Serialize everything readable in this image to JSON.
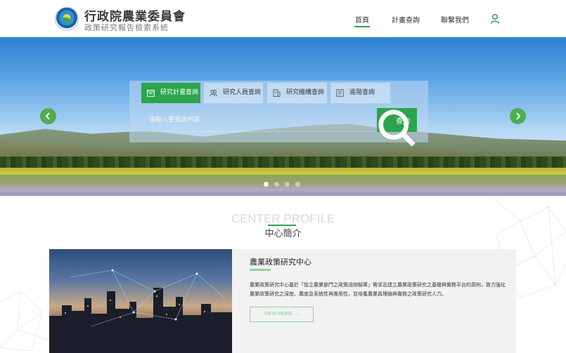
{
  "header": {
    "title": "行政院農業委員會",
    "subtitle": "政策研究報告檢索系統",
    "nav": [
      {
        "label": "首頁",
        "active": true
      },
      {
        "label": "計畫查詢",
        "active": false
      },
      {
        "label": "聯繫我們",
        "active": false
      }
    ],
    "user_icon": "user-icon",
    "accent_color": "#2ca44b"
  },
  "hero": {
    "tabs": [
      {
        "label": "研究計畫查詢",
        "icon": "document-icon",
        "active": true
      },
      {
        "label": "研究人員查詢",
        "icon": "people-icon",
        "active": false
      },
      {
        "label": "研究機構查詢",
        "icon": "building-icon",
        "active": false
      },
      {
        "label": "進階查詢",
        "icon": "advanced-search-icon",
        "active": false
      }
    ],
    "search_placeholder": "請輸入要查詢內容",
    "search_button": "查詢",
    "prev_icon": "chevron-left-icon",
    "next_icon": "chevron-right-icon",
    "slide_count": 4,
    "active_slide": 1
  },
  "profile": {
    "heading_en": "CENTER PROFILE",
    "heading_zh": "中心簡介",
    "card": {
      "title": "農業政策研究中心",
      "description": "農業政策研究中心基於「設立農業部門之政策諮詢智庫」需求及建立農業政策研究之基礎與實務平台的原則，致力強化農業政策研究之深度、廣度及系統性與應用性，並培養農業員理論與實務之政策研究人力。",
      "more_label": "VIEW MORE  →"
    }
  }
}
